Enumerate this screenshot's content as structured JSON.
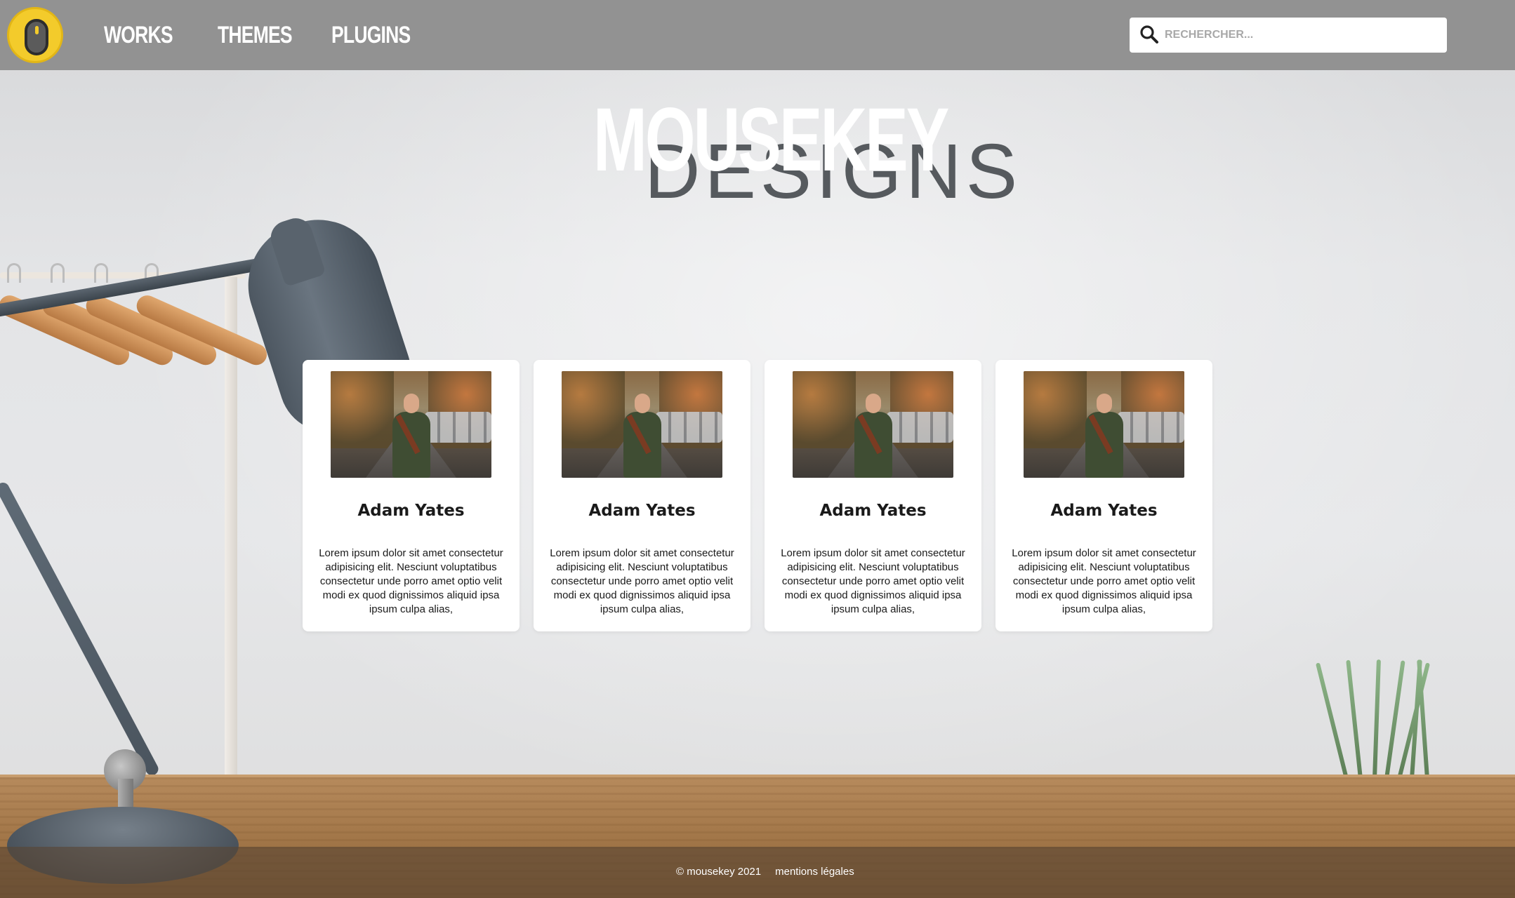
{
  "nav": {
    "items": [
      {
        "label": "WORKS"
      },
      {
        "label": "THEMES"
      },
      {
        "label": "PLUGINS"
      }
    ]
  },
  "search": {
    "placeholder": "RECHERCHER...",
    "value": ""
  },
  "hero": {
    "title": "MOUSEKEY",
    "subtitle": "DESIGNS"
  },
  "cards": [
    {
      "name": "Adam Yates",
      "text": "Lorem ipsum dolor sit amet consectetur adipisicing elit. Nesciunt voluptatibus consectetur unde porro amet optio velit modi ex quod dignissimos aliquid ipsa ipsum culpa alias,"
    },
    {
      "name": "Adam Yates",
      "text": "Lorem ipsum dolor sit amet consectetur adipisicing elit. Nesciunt voluptatibus consectetur unde porro amet optio velit modi ex quod dignissimos aliquid ipsa ipsum culpa alias,"
    },
    {
      "name": "Adam Yates",
      "text": "Lorem ipsum dolor sit amet consectetur adipisicing elit. Nesciunt voluptatibus consectetur unde porro amet optio velit modi ex quod dignissimos aliquid ipsa ipsum culpa alias,"
    },
    {
      "name": "Adam Yates",
      "text": "Lorem ipsum dolor sit amet consectetur adipisicing elit. Nesciunt voluptatibus consectetur unde porro amet optio velit modi ex quod dignissimos aliquid ipsa ipsum culpa alias,"
    }
  ],
  "footer": {
    "copyright": "© mousekey 2021",
    "legal_link": "mentions légales"
  },
  "colors": {
    "header_bg": "#929292",
    "logo_yellow": "#f3cb2b",
    "subtitle_gray": "#565a5e",
    "card_bg": "#ffffff",
    "footer_bg": "#5a4634"
  },
  "icons": {
    "logo": "mouse-logo-icon",
    "search": "search-icon",
    "card_photo": "person-photo"
  }
}
